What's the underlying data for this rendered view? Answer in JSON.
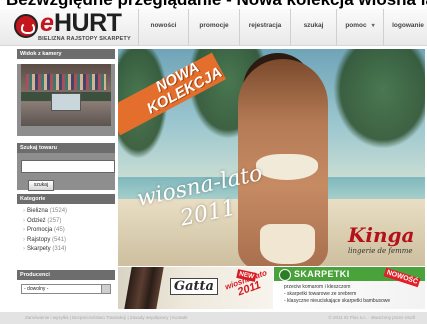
{
  "top_banner": "Bezwzględne przeglądanie - Nowa kolekcja wiosna lato 2011",
  "logo": {
    "e": "e",
    "hurt": "HURT",
    "tagline": "BIELIZNA RAJSTOPY SKARPETY"
  },
  "nav": {
    "items": [
      {
        "label": "nowości"
      },
      {
        "label": "promocje"
      },
      {
        "label": "rejestracja"
      },
      {
        "label": "szukaj"
      },
      {
        "label": "pomoc",
        "caret": "▾"
      },
      {
        "label": "logowanie"
      }
    ]
  },
  "sidebar": {
    "camera": {
      "title": "Widok z kamery"
    },
    "search": {
      "title": "Szukaj towaru",
      "value": "",
      "button": "szukaj"
    },
    "categories": {
      "title": "Kategorie",
      "items": [
        {
          "label": "Bielizna",
          "count": "(1524)"
        },
        {
          "label": "Odzież",
          "count": "(257)"
        },
        {
          "label": "Promocja",
          "count": "(45)"
        },
        {
          "label": "Rajstopy",
          "count": "(541)"
        },
        {
          "label": "Skarpety",
          "count": "(314)"
        }
      ]
    },
    "producers": {
      "title": "Producenci",
      "selected": "- dowolny -"
    }
  },
  "hero": {
    "badge_line1": "NOWA",
    "badge_line2": "KOLEKCJA",
    "season": "wiosna-lato",
    "year": "2011",
    "brand": "Kinga",
    "brand_sub": "lingerie de femme"
  },
  "promo_gatta": {
    "brand": "Gatta",
    "new_badge": "NEW",
    "season": "wiosna-lato",
    "year": "2011"
  },
  "promo_skarpetki": {
    "title": "SKARPETKI",
    "badge": "NOWOŚĆ",
    "line1": "przeciw komarom i kleszczom",
    "line2": "- skarpetki towarowe ze srebrem",
    "line3": "- klasyczne nieuciskające skarpetki bambusowe"
  },
  "footer": {
    "links": "Zamówienie i wysyłka | Bezpieczeństwo Transakcji | Zasady współpracy | Kontakt",
    "copyright": "© 2011 ID Plus s.c. · stworzony przez eSoft"
  }
}
